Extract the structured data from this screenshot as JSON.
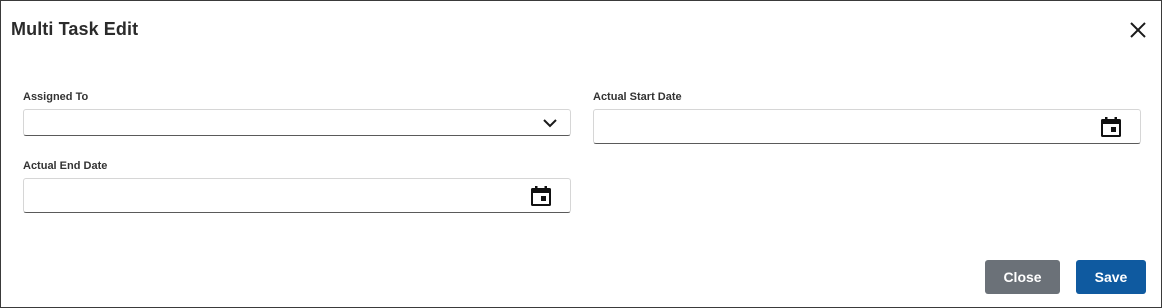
{
  "dialog": {
    "title": "Multi Task Edit"
  },
  "fields": {
    "assigned_to": {
      "label": "Assigned To",
      "value": ""
    },
    "actual_start_date": {
      "label": "Actual Start Date",
      "value": ""
    },
    "actual_end_date": {
      "label": "Actual End Date",
      "value": ""
    }
  },
  "buttons": {
    "close_label": "Close",
    "save_label": "Save"
  },
  "icons": {
    "close": "close-icon",
    "dropdown": "chevron-down-icon",
    "calendar": "calendar-icon"
  },
  "colors": {
    "close_button": "#6b7178",
    "save_button": "#0f5aa0",
    "border": "#3a3a3a"
  }
}
